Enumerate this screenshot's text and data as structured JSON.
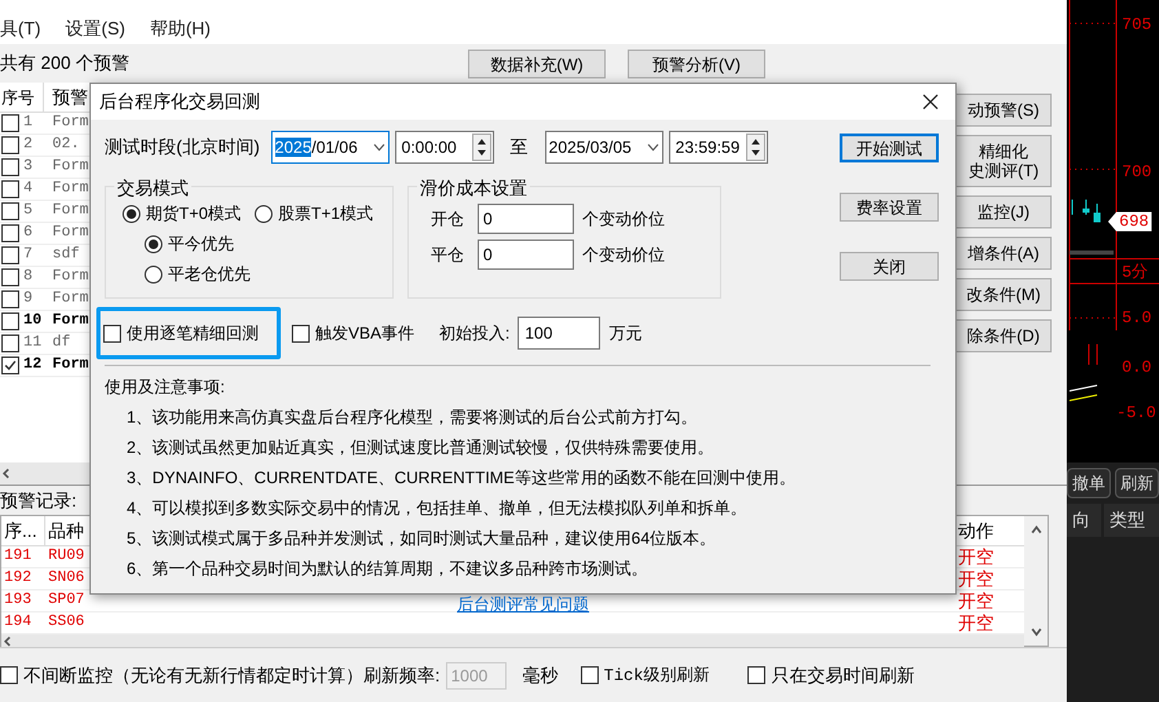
{
  "menu": [
    "具(T)",
    "设置(S)",
    "帮助(H)"
  ],
  "alert_count": "共有 200 个预警",
  "top_buttons": [
    "数据补充(W)",
    "预警分析(V)"
  ],
  "side_buttons": [
    {
      "lines": [
        "动预警(S)"
      ]
    },
    {
      "lines": [
        "精细化",
        "史测评(T)"
      ]
    },
    {
      "lines": [
        "监控(J)"
      ]
    },
    {
      "lines": [
        "增条件(A)"
      ]
    },
    {
      "lines": [
        "改条件(M)"
      ]
    },
    {
      "lines": [
        "除条件(D)"
      ]
    }
  ],
  "alert_list": {
    "columns": [
      "序号",
      "预警"
    ],
    "rows": [
      {
        "index": "1",
        "name": "Form",
        "checked": false,
        "bold": false
      },
      {
        "index": "2",
        "name": "02.",
        "checked": false,
        "bold": false
      },
      {
        "index": "3",
        "name": "Form",
        "checked": false,
        "bold": false
      },
      {
        "index": "4",
        "name": "Form",
        "checked": false,
        "bold": false
      },
      {
        "index": "5",
        "name": "Form",
        "checked": false,
        "bold": false
      },
      {
        "index": "6",
        "name": "Form",
        "checked": false,
        "bold": false
      },
      {
        "index": "7",
        "name": "sdf",
        "checked": false,
        "bold": false
      },
      {
        "index": "8",
        "name": "Form",
        "checked": false,
        "bold": false
      },
      {
        "index": "9",
        "name": "Form",
        "checked": false,
        "bold": false
      },
      {
        "index": "10",
        "name": "Form",
        "checked": false,
        "bold": true
      },
      {
        "index": "11",
        "name": "df",
        "checked": false,
        "bold": false
      },
      {
        "index": "12",
        "name": "Form",
        "checked": true,
        "bold": true
      }
    ]
  },
  "record_label": "预警记录:",
  "records": {
    "columns": [
      "序...",
      "品种",
      "动作"
    ],
    "rows": [
      {
        "index": "191",
        "symbol": "RU09",
        "action": "开空"
      },
      {
        "index": "192",
        "symbol": "SN06",
        "action": "开空"
      },
      {
        "index": "193",
        "symbol": "SP07",
        "action": "开空"
      },
      {
        "index": "194",
        "symbol": "SS06",
        "action": "开空"
      }
    ]
  },
  "bottom_bar": {
    "monitor": {
      "label": "不间断监控（无论有无新行情都定时计算）刷新频率:",
      "checked": false
    },
    "interval": {
      "value": "1000",
      "disabled": true
    },
    "unit": "毫秒",
    "tick": {
      "label": "Tick级别刷新",
      "checked": false
    },
    "trading_only": {
      "label": "只在交易时间刷新",
      "checked": false
    }
  },
  "chart": {
    "price_labels": [
      "705",
      "700",
      "5.0",
      "0.0",
      "-5.0"
    ],
    "price_tag": "698",
    "period": "5分",
    "buttons": [
      "撤单",
      "刷新"
    ],
    "columns": [
      "向",
      "类型"
    ]
  },
  "dialog": {
    "title": "后台程序化交易回测",
    "period_label": "测试时段(北京时间)",
    "start_date": {
      "selected_part": "2025",
      "rest": "/01/06"
    },
    "start_time": "0:00:00",
    "to": "至",
    "end_date": "2025/03/05",
    "end_time": "23:59:59",
    "mode_group": {
      "title": "交易模式",
      "modes": [
        {
          "label": "期货T+0模式",
          "selected": true
        },
        {
          "label": "股票T+1模式",
          "selected": false
        }
      ],
      "close_rules": [
        {
          "label": "平今优先",
          "selected": true
        },
        {
          "label": "平老仓优先",
          "selected": false
        }
      ]
    },
    "slippage_group": {
      "title": "滑价成本设置",
      "rows": [
        {
          "label": "开仓",
          "value": "0",
          "unit": "个变动价位"
        },
        {
          "label": "平仓",
          "value": "0",
          "unit": "个变动价位"
        }
      ]
    },
    "fine_backtest": {
      "label": "使用逐笔精细回测",
      "checked": false
    },
    "vba_events": {
      "label": "触发VBA事件",
      "checked": false
    },
    "initial": {
      "label": "初始投入:",
      "value": "100",
      "unit": "万元"
    },
    "buttons": [
      {
        "label": "开始测试",
        "default": true
      },
      {
        "label": "费率设置",
        "default": false
      },
      {
        "label": "关闭",
        "default": false
      }
    ],
    "notes_title": "使用及注意事项:",
    "notes": [
      "1、该功能用来高仿真实盘后台程序化模型，需要将测试的后台公式前方打勾。",
      "2、该测试虽然更加贴近真实，但测试速度比普通测试较慢，仅供特殊需要使用。",
      "3、DYNAINFO、CURRENTDATE、CURRENTTIME等这些常用的函数不能在回测中使用。",
      "4、可以模拟到多数实际交易中的情况，包括挂单、撤单，但无法模拟队列单和拆单。",
      "5、该测试模式属于多品种并发测试，如同时测试大量品种，建议使用64位版本。",
      "6、第一个品种交易时间为默认的结算周期，不建议多品种跨市场测试。"
    ],
    "faq_link": "后台测评常见问题"
  }
}
